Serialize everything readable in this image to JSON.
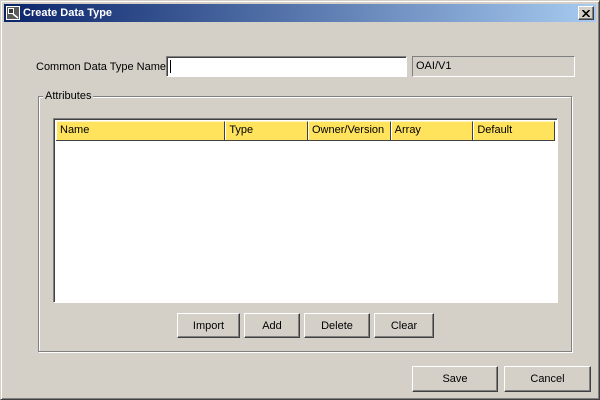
{
  "window": {
    "title": "Create Data Type",
    "icon": "app-window-icon",
    "close_icon": "close-icon"
  },
  "form": {
    "name_label": "Common Data Type Name:",
    "name_value": "",
    "owner_version": "OAI/V1"
  },
  "attributes": {
    "group_label": "Attributes",
    "columns": [
      "Name",
      "Type",
      "Owner/Version",
      "Array",
      "Default"
    ],
    "rows": [],
    "header_color": "#ffe35c",
    "buttons": {
      "import": "Import",
      "add": "Add",
      "delete": "Delete",
      "clear": "Clear"
    }
  },
  "footer": {
    "save": "Save",
    "cancel": "Cancel"
  },
  "colors": {
    "title_gradient_start": "#0a246a",
    "title_gradient_end": "#a6caf0",
    "dialog_background": "#d4d0c8"
  }
}
